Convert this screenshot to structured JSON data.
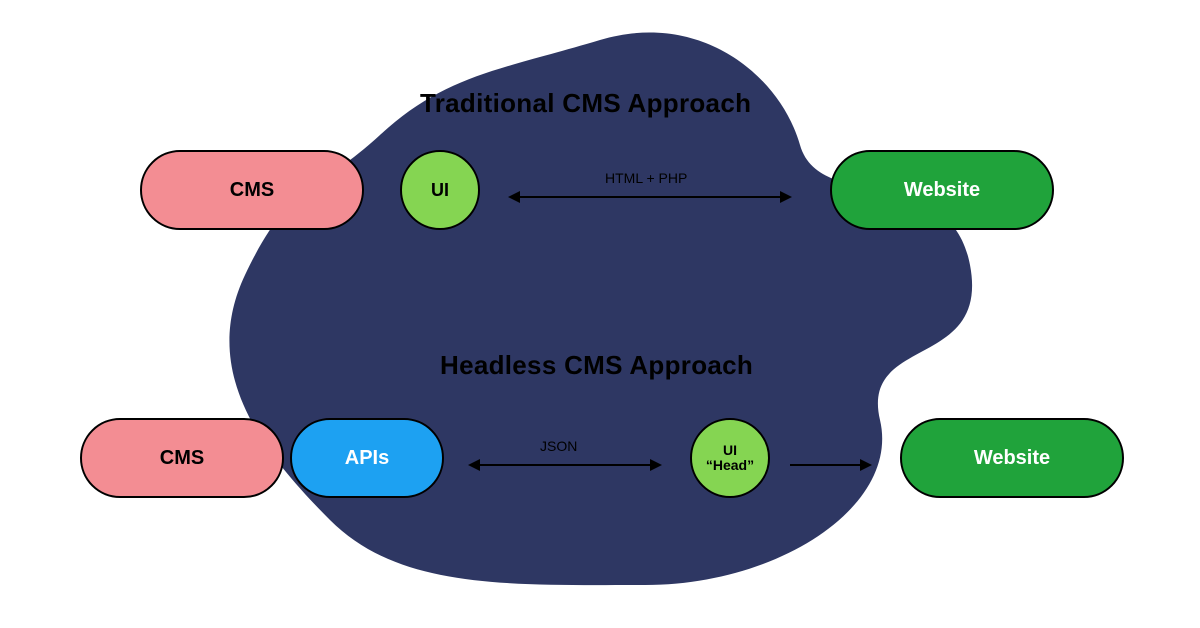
{
  "colors": {
    "blob": "#2E3763",
    "pink": "#F38D93",
    "lime": "#85D552",
    "green": "#20A33B",
    "blue": "#1DA1F2"
  },
  "traditional": {
    "title": "Traditional CMS Approach",
    "cms": "CMS",
    "ui": "UI",
    "arrow_label": "HTML + PHP",
    "website": "Website"
  },
  "headless": {
    "title": "Headless CMS Approach",
    "cms": "CMS",
    "apis": "APIs",
    "arrow_label": "JSON",
    "ui_head_line1": "UI",
    "ui_head_line2": "“Head”",
    "website": "Website"
  }
}
